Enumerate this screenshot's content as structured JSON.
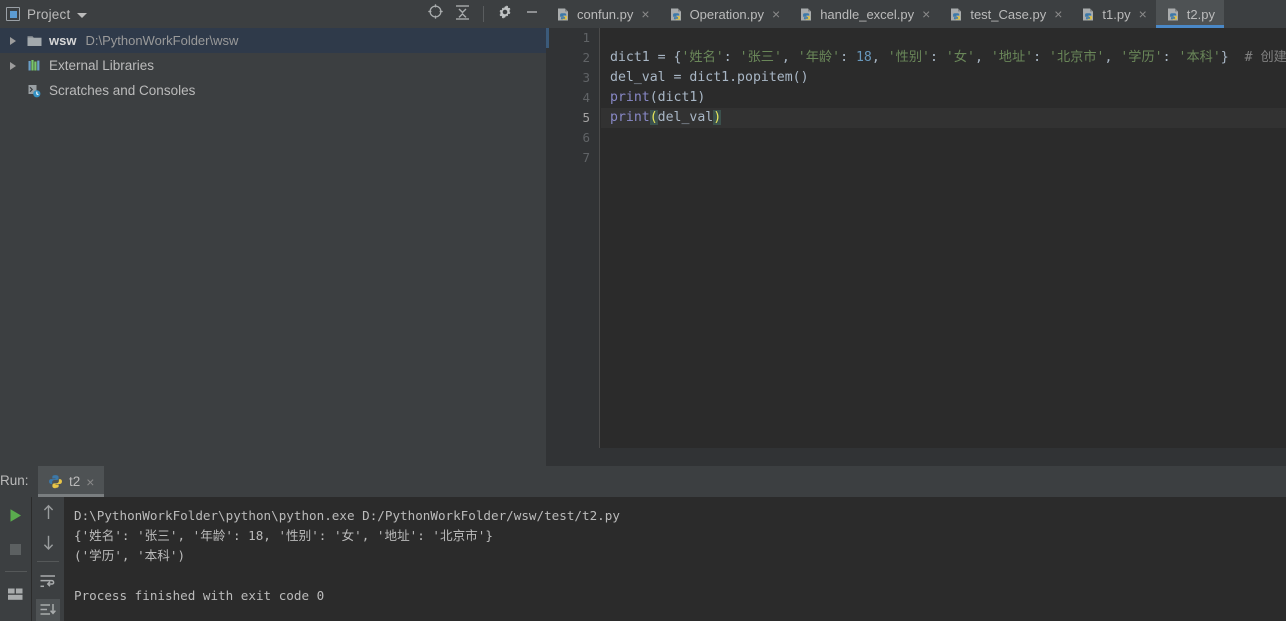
{
  "project_panel": {
    "title": "Project",
    "icons": [
      {
        "name": "locate-target-icon",
        "glyph": "target"
      },
      {
        "name": "collapse-all-icon",
        "glyph": "collapse"
      },
      {
        "name": "settings-gear-icon",
        "glyph": "gear"
      },
      {
        "name": "hide-panel-icon",
        "glyph": "minus"
      }
    ],
    "tree": [
      {
        "name": "wsw",
        "path": "D:\\PythonWorkFolder\\wsw",
        "icon": "folder-icon",
        "expandable": true,
        "selected": true
      },
      {
        "name": "External Libraries",
        "path": "",
        "icon": "library-bars-icon",
        "expandable": true,
        "selected": false
      },
      {
        "name": "Scratches and Consoles",
        "path": "",
        "icon": "scratches-clock-icon",
        "expandable": false,
        "selected": false
      }
    ]
  },
  "editor": {
    "tabs": [
      {
        "label": "confun.py",
        "active": false
      },
      {
        "label": "Operation.py",
        "active": false
      },
      {
        "label": "handle_excel.py",
        "active": false
      },
      {
        "label": "test_Case.py",
        "active": false
      },
      {
        "label": "t1.py",
        "active": false
      },
      {
        "label": "t2.py",
        "active": true
      }
    ],
    "close_glyph": "×",
    "line_numbers": [
      "1",
      "2",
      "3",
      "4",
      "5",
      "6",
      "7"
    ],
    "current_line": 5,
    "lines": [
      {
        "n": 1,
        "tokens": []
      },
      {
        "n": 2,
        "tokens": [
          {
            "t": "dict1 ",
            "c": "s-var"
          },
          {
            "t": "= ",
            "c": "s-op"
          },
          {
            "t": "{",
            "c": "s-op"
          },
          {
            "t": "'姓名'",
            "c": "s-str"
          },
          {
            "t": ": ",
            "c": "s-op"
          },
          {
            "t": "'张三'",
            "c": "s-str"
          },
          {
            "t": ", ",
            "c": "s-op"
          },
          {
            "t": "'年龄'",
            "c": "s-str"
          },
          {
            "t": ": ",
            "c": "s-op"
          },
          {
            "t": "18",
            "c": "s-num"
          },
          {
            "t": ", ",
            "c": "s-op"
          },
          {
            "t": "'性别'",
            "c": "s-str"
          },
          {
            "t": ": ",
            "c": "s-op"
          },
          {
            "t": "'女'",
            "c": "s-str"
          },
          {
            "t": ", ",
            "c": "s-op"
          },
          {
            "t": "'地址'",
            "c": "s-str"
          },
          {
            "t": ": ",
            "c": "s-op"
          },
          {
            "t": "'北京市'",
            "c": "s-str"
          },
          {
            "t": ", ",
            "c": "s-op"
          },
          {
            "t": "'学历'",
            "c": "s-str"
          },
          {
            "t": ": ",
            "c": "s-op"
          },
          {
            "t": "'本科'",
            "c": "s-str"
          },
          {
            "t": "}",
            "c": "s-op"
          },
          {
            "t": "  # 创建字典",
            "c": "s-com"
          }
        ]
      },
      {
        "n": 3,
        "tokens": [
          {
            "t": "del_val ",
            "c": "s-var"
          },
          {
            "t": "= ",
            "c": "s-op"
          },
          {
            "t": "dict1.popitem()",
            "c": "s-var"
          }
        ]
      },
      {
        "n": 4,
        "tokens": [
          {
            "t": "print",
            "c": "s-fn"
          },
          {
            "t": "(dict1)",
            "c": "s-var"
          }
        ]
      },
      {
        "n": 5,
        "tokens": [
          {
            "t": "print",
            "c": "s-fn"
          },
          {
            "t": "(",
            "c": "s-brk"
          },
          {
            "t": "del_val",
            "c": "s-var"
          },
          {
            "t": ")",
            "c": "s-brk"
          }
        ]
      },
      {
        "n": 6,
        "tokens": []
      },
      {
        "n": 7,
        "tokens": []
      }
    ]
  },
  "run_panel": {
    "label": "Run:",
    "tab_label": "t2",
    "close_glyph": "×",
    "toolbar_left": [
      {
        "name": "run-button",
        "glyph": "play"
      },
      {
        "name": "stop-button",
        "glyph": "stop"
      },
      {
        "name": "layout-button",
        "glyph": "layout"
      }
    ],
    "toolbar_right": [
      {
        "name": "prev-occurrence-button",
        "glyph": "arrow-up"
      },
      {
        "name": "next-occurrence-button",
        "glyph": "arrow-down"
      },
      {
        "name": "soft-wrap-button",
        "glyph": "wrap"
      },
      {
        "name": "scroll-to-end-button",
        "glyph": "scroll-end"
      }
    ],
    "console_lines": [
      "D:\\PythonWorkFolder\\python\\python.exe D:/PythonWorkFolder/wsw/test/t2.py",
      "{'姓名': '张三', '年龄': 18, '性别': '女', '地址': '北京市'}",
      "('学历', '本科')",
      "",
      "Process finished with exit code 0"
    ]
  },
  "colors": {
    "panel_bg": "#3c3f41",
    "editor_bg": "#2b2b2b",
    "selection_blue": "#2f3a4a",
    "accent_blue": "#4a88c7",
    "string_green": "#6a8759",
    "number_blue": "#6897bb",
    "keyword_purple": "#8888c6",
    "comment_gray": "#808080",
    "text_gray": "#bbbbbb"
  }
}
